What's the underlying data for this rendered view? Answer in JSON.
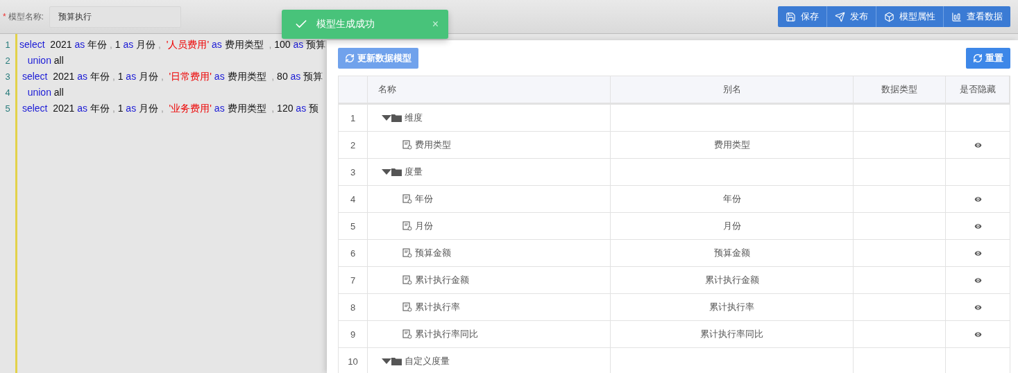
{
  "header": {
    "required_mark": "*",
    "model_name_label": "模型名称:",
    "model_name_value": "预算执行",
    "actions": [
      {
        "label": "保存"
      },
      {
        "label": "发布"
      },
      {
        "label": "模型属性"
      },
      {
        "label": "查看数据"
      }
    ]
  },
  "toast": {
    "message": "模型生成成功",
    "close": "×"
  },
  "editor": {
    "lines": [
      {
        "no": "1",
        "tokens": [
          {
            "kind": "keyword",
            "text": "select"
          },
          {
            "kind": "plain",
            "text": "  2021 "
          },
          {
            "kind": "keyword",
            "text": "as"
          },
          {
            "kind": "plain",
            "text": " 年份 "
          },
          {
            "kind": "punct",
            "text": ","
          },
          {
            "kind": "plain",
            "text": " 1 "
          },
          {
            "kind": "keyword",
            "text": "as"
          },
          {
            "kind": "plain",
            "text": " 月份 "
          },
          {
            "kind": "punct",
            "text": ",  "
          },
          {
            "kind": "string",
            "text": "'人员费用'"
          },
          {
            "kind": "keyword",
            "text": " as"
          },
          {
            "kind": "plain",
            "text": " 费用类型  "
          },
          {
            "kind": "punct",
            "text": ","
          },
          {
            "kind": "plain",
            "text": " 100 "
          },
          {
            "kind": "keyword",
            "text": "as"
          },
          {
            "kind": "plain",
            "text": " 预算"
          }
        ]
      },
      {
        "no": "2",
        "tokens": [
          {
            "kind": "keyword",
            "text": "   union"
          },
          {
            "kind": "plain",
            "text": " all"
          }
        ]
      },
      {
        "no": "3",
        "tokens": [
          {
            "kind": "keyword",
            "text": " select"
          },
          {
            "kind": "plain",
            "text": "  2021 "
          },
          {
            "kind": "keyword",
            "text": "as"
          },
          {
            "kind": "plain",
            "text": " 年份 "
          },
          {
            "kind": "punct",
            "text": ","
          },
          {
            "kind": "plain",
            "text": " 1 "
          },
          {
            "kind": "keyword",
            "text": "as"
          },
          {
            "kind": "plain",
            "text": " 月份 "
          },
          {
            "kind": "punct",
            "text": ",  "
          },
          {
            "kind": "string",
            "text": "'日常费用'"
          },
          {
            "kind": "keyword",
            "text": " as"
          },
          {
            "kind": "plain",
            "text": " 费用类型  "
          },
          {
            "kind": "punct",
            "text": ","
          },
          {
            "kind": "plain",
            "text": " 80 "
          },
          {
            "kind": "keyword",
            "text": "as"
          },
          {
            "kind": "plain",
            "text": " 预算"
          }
        ]
      },
      {
        "no": "4",
        "tokens": [
          {
            "kind": "keyword",
            "text": "   union"
          },
          {
            "kind": "plain",
            "text": " all"
          }
        ]
      },
      {
        "no": "5",
        "tokens": [
          {
            "kind": "keyword",
            "text": " select"
          },
          {
            "kind": "plain",
            "text": "  2021 "
          },
          {
            "kind": "keyword",
            "text": "as"
          },
          {
            "kind": "plain",
            "text": " 年份 "
          },
          {
            "kind": "punct",
            "text": ","
          },
          {
            "kind": "plain",
            "text": " 1 "
          },
          {
            "kind": "keyword",
            "text": "as"
          },
          {
            "kind": "plain",
            "text": " 月份 "
          },
          {
            "kind": "punct",
            "text": ",  "
          },
          {
            "kind": "string",
            "text": "'业务费用'"
          },
          {
            "kind": "keyword",
            "text": " as"
          },
          {
            "kind": "plain",
            "text": " 费用类型  "
          },
          {
            "kind": "punct",
            "text": ","
          },
          {
            "kind": "plain",
            "text": " 120 "
          },
          {
            "kind": "keyword",
            "text": "as"
          },
          {
            "kind": "plain",
            "text": " 预"
          }
        ]
      }
    ]
  },
  "panel": {
    "update_button": {
      "label": "更新数据模型",
      "disabled": true
    },
    "reset_button": {
      "label": "重置"
    },
    "table": {
      "columns": [
        "名称",
        "别名",
        "数据类型",
        "是否隐藏"
      ],
      "rows": [
        {
          "no": "1",
          "kind": "folder",
          "name": "维度",
          "expanded": true,
          "children": [
            {
              "no": "2",
              "kind": "field",
              "name": "费用类型",
              "alias": "费用类型",
              "visible": true
            }
          ]
        },
        {
          "no": "3",
          "kind": "folder",
          "name": "度量",
          "expanded": true,
          "children": [
            {
              "no": "4",
              "kind": "field",
              "name": "年份",
              "alias": "年份",
              "visible": true
            },
            {
              "no": "5",
              "kind": "field",
              "name": "月份",
              "alias": "月份",
              "visible": true
            },
            {
              "no": "6",
              "kind": "field",
              "name": "预算金额",
              "alias": "预算金额",
              "visible": true
            },
            {
              "no": "7",
              "kind": "field",
              "name": "累计执行金额",
              "alias": "累计执行金额",
              "visible": true
            },
            {
              "no": "8",
              "kind": "field",
              "name": "累计执行率",
              "alias": "累计执行率",
              "visible": true
            },
            {
              "no": "9",
              "kind": "field",
              "name": "累计执行率同比",
              "alias": "累计执行率同比",
              "visible": true
            }
          ]
        },
        {
          "no": "10",
          "kind": "folder",
          "name": "自定义度量",
          "expanded": true
        }
      ]
    }
  }
}
